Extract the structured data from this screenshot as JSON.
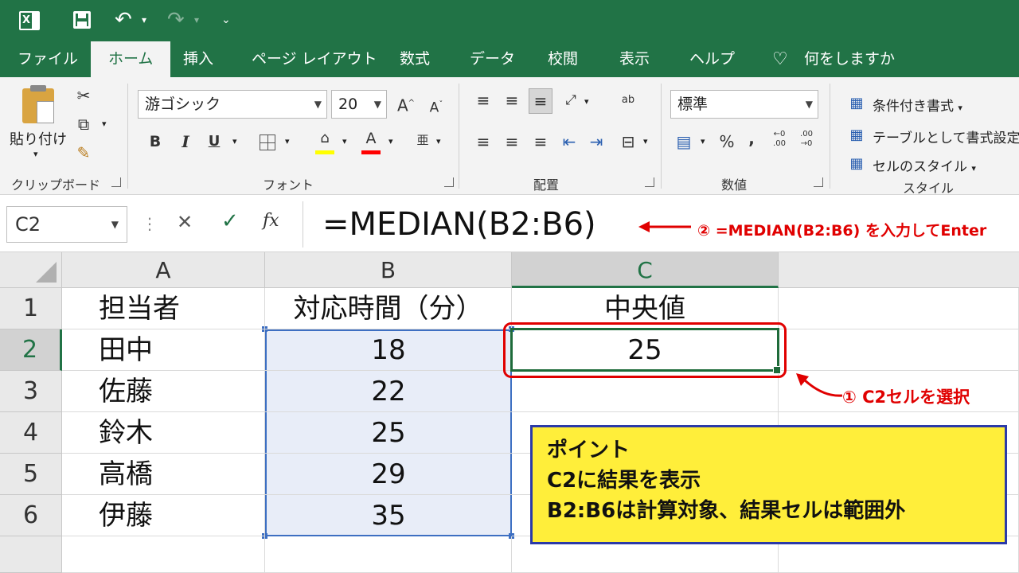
{
  "quick_access": {
    "app_icon": "excel-icon",
    "save_icon": "save-icon",
    "undo_icon": "undo-icon",
    "redo_icon": "redo-icon",
    "customize_icon": "customize-qat-icon"
  },
  "tabs": [
    "ファイル",
    "ホーム",
    "挿入",
    "ページ レイアウト",
    "数式",
    "データ",
    "校閲",
    "表示",
    "ヘルプ"
  ],
  "active_tab": "ホーム",
  "tell_me": "何をしますか",
  "ribbon": {
    "clipboard": {
      "paste_label": "貼り付け",
      "group_label": "クリップボード"
    },
    "font": {
      "font_name": "游ゴシック",
      "font_size": "20",
      "bold": "B",
      "italic": "I",
      "underline": "U",
      "group_label": "フォント",
      "fill_color": "#ffff00",
      "font_color": "#ff0000"
    },
    "alignment": {
      "group_label": "配置"
    },
    "number": {
      "format": "標準",
      "percent": "%",
      "comma": ",",
      "group_label": "数値"
    },
    "styles": {
      "conditional": "条件付き書式",
      "table": "テーブルとして書式設定",
      "cell_styles": "セルのスタイル",
      "group_label": "スタイル"
    }
  },
  "formula_bar": {
    "name_box": "C2",
    "cancel": "✕",
    "enter": "✓",
    "fx": "fx",
    "formula": "=MEDIAN(B2:B6)"
  },
  "sheet": {
    "columns": [
      "A",
      "B",
      "C"
    ],
    "rows": [
      "1",
      "2",
      "3",
      "4",
      "5",
      "6"
    ],
    "cells": {
      "A1": "担当者",
      "B1": "対応時間（分）",
      "C1": "中央値",
      "A2": "田中",
      "B2": "18",
      "C2": "25",
      "A3": "佐藤",
      "B3": "22",
      "A4": "鈴木",
      "B4": "25",
      "A5": "高橋",
      "B5": "29",
      "A6": "伊藤",
      "B6": "35"
    },
    "selected_cell": "C2",
    "highlight_range": "B2:B6"
  },
  "annotations": {
    "step2": "② =MEDIAN(B2:B6) を入力してEnter",
    "step1": "① C2セルを選択",
    "point_box": {
      "title": "ポイント",
      "line1": "C2に結果を表示",
      "line2": "B2:B6は計算対象、結果セルは範囲外"
    }
  },
  "colors": {
    "excel_green": "#217346",
    "annotation_red": "#e00000",
    "point_box_bg": "#ffee3a",
    "point_box_border": "#2b3aa8",
    "range_fill": "#e8edf8"
  }
}
